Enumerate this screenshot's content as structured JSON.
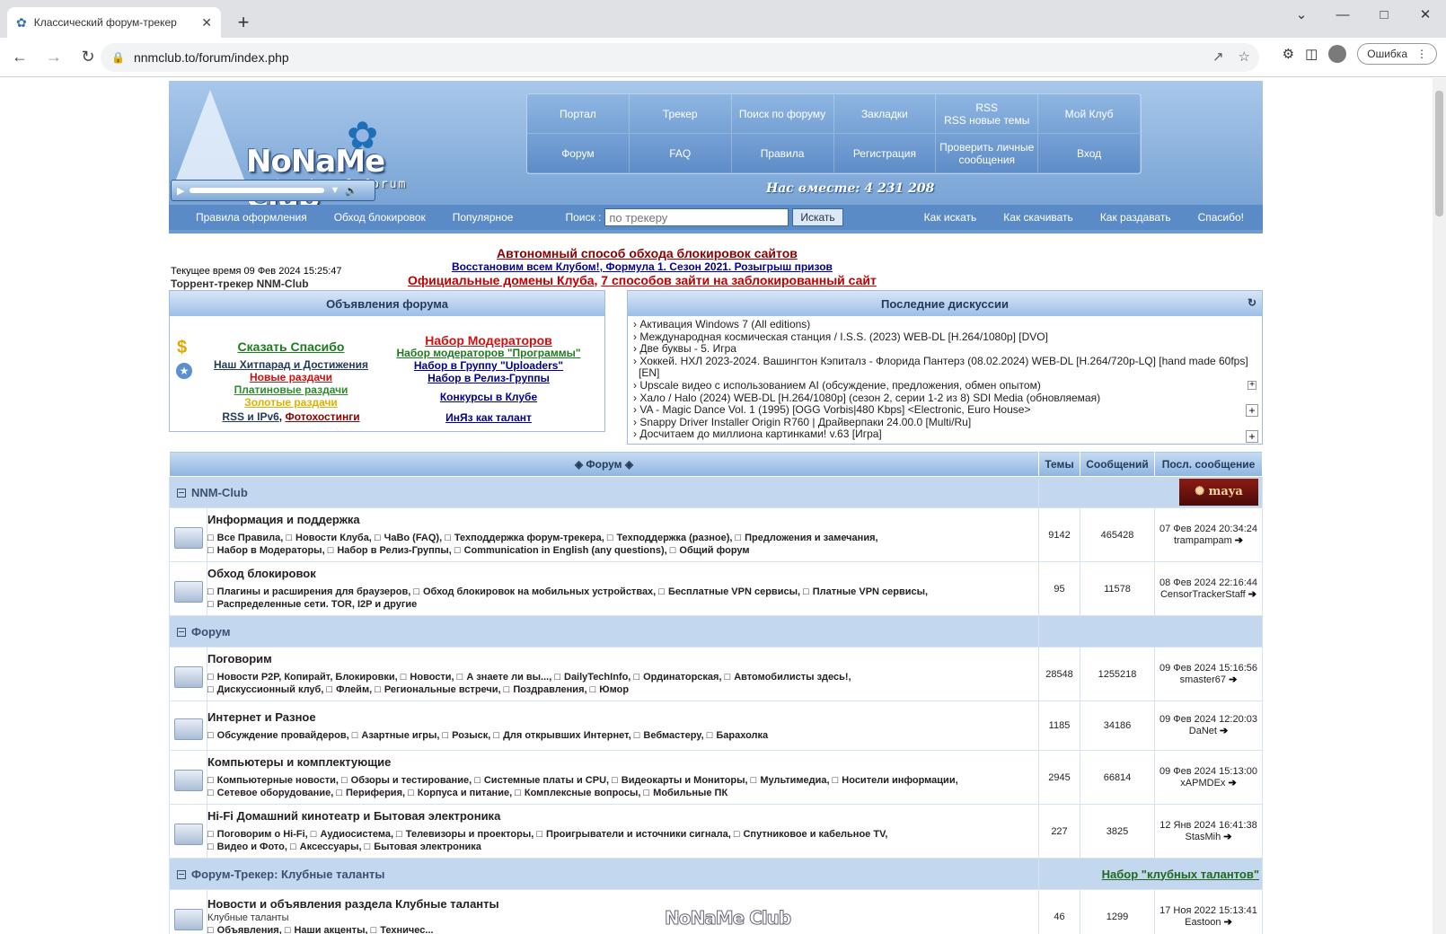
{
  "browser": {
    "tab_title": "Классический форум-трекер",
    "url": "nnmclub.to/forum/index.php",
    "error_label": "Ошибка"
  },
  "header": {
    "logo_title": "NoNaMe Club",
    "logo_sub": "tracker & forum",
    "menu": [
      "Портал",
      "Трекер",
      "Поиск по форуму",
      "Закладки",
      "RSS\nRSS новые темы",
      "Мой Клуб",
      "Форум",
      "FAQ",
      "Правила",
      "Регистрация",
      "Проверить личные сообщения",
      "Вход"
    ],
    "together": "Нас вместе: 4 231 208",
    "subnav": {
      "left": [
        "Правила оформления",
        "Обход блокировок",
        "Популярное"
      ],
      "search_label": "Поиск :",
      "search_placeholder": "по трекеру",
      "search_button": "Искать",
      "right": [
        "Как искать",
        "Как скачивать",
        "Как раздавать",
        "Спасибо!"
      ]
    }
  },
  "announce": {
    "line1": "Автономный способ обхода блокировок сайтов",
    "line2a": "Восстановим всем Клубом!",
    "line2b": "Формула 1. Сезон 2021. Розыгрыш призов",
    "line3a": "Официальные домены Клуба",
    "line3b": "7 способов зайти на заблокированный сайт",
    "time": "Текущее время 09 Фев 2024 15:25:47",
    "tracker": "Торрент-трекер NNM-Club"
  },
  "left_panel": {
    "title": "Объявления форума",
    "col1": {
      "big": "Сказать Спасибо",
      "items": [
        "Наш Хитпарад и Достижения",
        "Новые раздачи",
        "Платиновые раздачи",
        "Золотые раздачи"
      ],
      "rss": "RSS и IPv6",
      "photo": "Фотохостинги"
    },
    "col2": {
      "big": "Набор Модераторов",
      "items": [
        "Набор модераторов \"Программы\"",
        "Набор в Группу \"Uploaders\"",
        "Набор в Релиз-Группы"
      ],
      "contests": "Конкурсы в Клубе",
      "talent": "ИнЯз как талант"
    }
  },
  "right_panel": {
    "title": "Последние дискуссии",
    "items": [
      "Активация Windows 7 (All editions)",
      "Международная космическая станция / I.S.S. (2023) WEB-DL [H.264/1080p] [DVO]",
      "Две буквы - 5. Игра",
      "Хоккей. НХЛ 2023-2024. Вашингтон Кэпиталз - Флорида Пантерз (08.02.2024) WEB-DL [H.264/720p-LQ] [hand made 60fps] [EN]",
      "Upscale видео с использованием AI (обсуждение, предложения, обмен опытом)",
      "Хало / Halo (2024) WEB-DL [H.264/1080p] (сезон 2, серии 1-2 из 8) SDI Media (обновляемая)",
      "VA - Magic Dance Vol. 1 (1995) [OGG Vorbis|480 Kbps] <Electronic, Euro House>",
      "Snappy Driver Installer Origin R760 | Драйверпаки 24.00.0 [Multi/Ru]",
      "Досчитаем до миллиона картинками! v.63 [Игра]"
    ]
  },
  "forum": {
    "head": {
      "forum": "Форум",
      "topics": "Темы",
      "posts": "Сообщений",
      "last": "Посл. сообщение"
    },
    "categories": [
      {
        "name": "NNM-Club",
        "badge": "maya",
        "rows": [
          {
            "name": "Информация и поддержка",
            "subs": [
              "Все Правила,",
              "Новости Клуба,",
              "ЧаВо (FAQ),",
              "Техподдержка форум-трекера,",
              "Техподдержка (разное),",
              "Предложения и замечания,",
              "Набор в Модераторы,",
              "Набор в Релиз-Группы,",
              "Communication in English (any questions),",
              "Общий форум"
            ],
            "topics": "9142",
            "posts": "465428",
            "date": "07 Фев 2024 20:34:24",
            "user": "trampampam"
          },
          {
            "name": "Обход блокировок",
            "subs": [
              "Плагины и расширения для браузеров,",
              "Обход блокировок на мобильных устройствах,",
              "Бесплатные VPN сервисы,",
              "Платные VPN сервисы,",
              "Распределенные сети. TOR, I2P и другие"
            ],
            "topics": "95",
            "posts": "11578",
            "date": "08 Фев 2024 22:16:44",
            "user": "CensorTrackerStaff"
          }
        ]
      },
      {
        "name": "Форум",
        "rows": [
          {
            "name": "Поговорим",
            "subs": [
              "Новости P2P, Копирайт, Блокировки,",
              "Новости,",
              "А знаете ли вы...,",
              "DailyTechInfo,",
              "Ординаторская,",
              "Автомобилисты здесь!,",
              "Дискуссионный клуб,",
              "Флейм,",
              "Региональные встречи,",
              "Поздравления,",
              "Юмор"
            ],
            "topics": "28548",
            "posts": "1255218",
            "date": "09 Фев 2024 15:16:56",
            "user": "smaster67"
          },
          {
            "name": "Интернет и Разное",
            "subs": [
              "Обсуждение провайдеров,",
              "Азартные игры,",
              "Розыск,",
              "Для открывших Интернет,",
              "Вебмастеру,",
              "Барахолка"
            ],
            "topics": "1185",
            "posts": "34186",
            "date": "09 Фев 2024 12:20:03",
            "user": "DaNet"
          },
          {
            "name": "Компьютеры и комплектующие",
            "subs": [
              "Компьютерные новости,",
              "Обзоры и тестирование,",
              "Системные платы и CPU,",
              "Видеокарты и Мониторы,",
              "Мультимедиа,",
              "Носители информации,",
              "Сетевое оборудование,",
              "Периферия,",
              "Корпуса и питание,",
              "Комплексные вопросы,",
              "Мобильные ПК"
            ],
            "topics": "2945",
            "posts": "66814",
            "date": "09 Фев 2024 15:13:00",
            "user": "xAPMDEx"
          },
          {
            "name": "Hi-Fi Домашний кинотеатр и Бытовая электроника",
            "subs": [
              "Поговорим о Hi-Fi,",
              "Аудиосистема,",
              "Телевизоры и проекторы,",
              "Проигрыватели и источники сигнала,",
              "Спутниковое и кабельное TV,",
              "Видео и Фото,",
              "Аксессуары,",
              "Бытовая электроника"
            ],
            "topics": "227",
            "posts": "3825",
            "date": "12 Янв 2024 16:41:38",
            "user": "StasMih"
          }
        ]
      },
      {
        "name": "Форум-Трекер: Клубные таланты",
        "link": "Набор \"клубных талантов\"",
        "rows": [
          {
            "name": "Новости и объявления раздела Клубные таланты",
            "desc": "Клубные таланты",
            "subs": [
              "Объявления,",
              "Наши акценты,",
              "Техничес..."
            ],
            "topics": "46",
            "posts": "1299",
            "date": "17 Ноя 2022 15:13:41",
            "user": "Eastoon"
          }
        ]
      }
    ]
  },
  "watermark": "NoNaMe Club"
}
